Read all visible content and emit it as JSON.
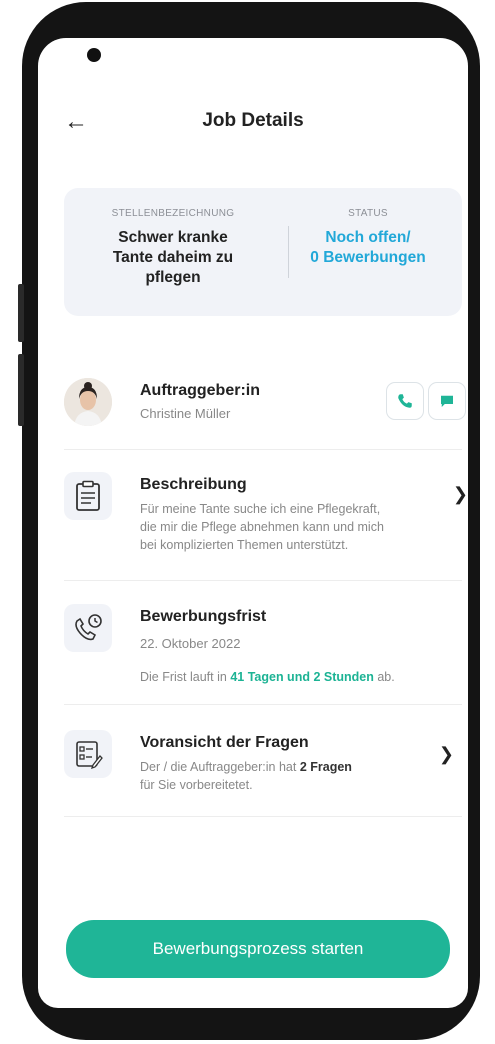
{
  "header": {
    "title": "Job Details"
  },
  "summary": {
    "position_caption": "STELLENBEZEICHNUNG",
    "position_lines": [
      "Schwer kranke",
      "Tante daheim zu",
      "pflegen"
    ],
    "status_caption": "STATUS",
    "status_lines": [
      "Noch offen/",
      "0 Bewerbungen"
    ]
  },
  "client": {
    "title": "Auftraggeber:in",
    "name": "Christine Müller"
  },
  "description": {
    "title": "Beschreibung",
    "lines": [
      "Für meine Tante suche ich eine Pflegekraft,",
      "die mir die Pflege abnehmen kann und mich",
      "bei komplizierten Themen unterstützt."
    ]
  },
  "deadline": {
    "title": "Bewerbungsfrist",
    "date": "22. Oktober 2022",
    "prefix": "Die Frist lauft in",
    "highlight": "41 Tagen und 2 Stunden",
    "suffix": "ab."
  },
  "questions": {
    "title": "Voransicht der Fragen",
    "line1_prefix": "Der / die Auftraggeber:in hat",
    "line1_bold": "2 Fragen",
    "line2": "für Sie vorbereitetet."
  },
  "cta_label": "Bewerbungsprozess starten",
  "colors": {
    "accent": "#1fb597",
    "status": "#22a8d8",
    "frame": "#141414"
  },
  "icons": {
    "back": "arrow-left-icon",
    "phone": "phone-icon",
    "chat": "chat-icon",
    "clipboard": "clipboard-icon",
    "phone_clock": "phone-clock-icon",
    "checklist": "checklist-icon",
    "chevron": "chevron-right-icon"
  }
}
